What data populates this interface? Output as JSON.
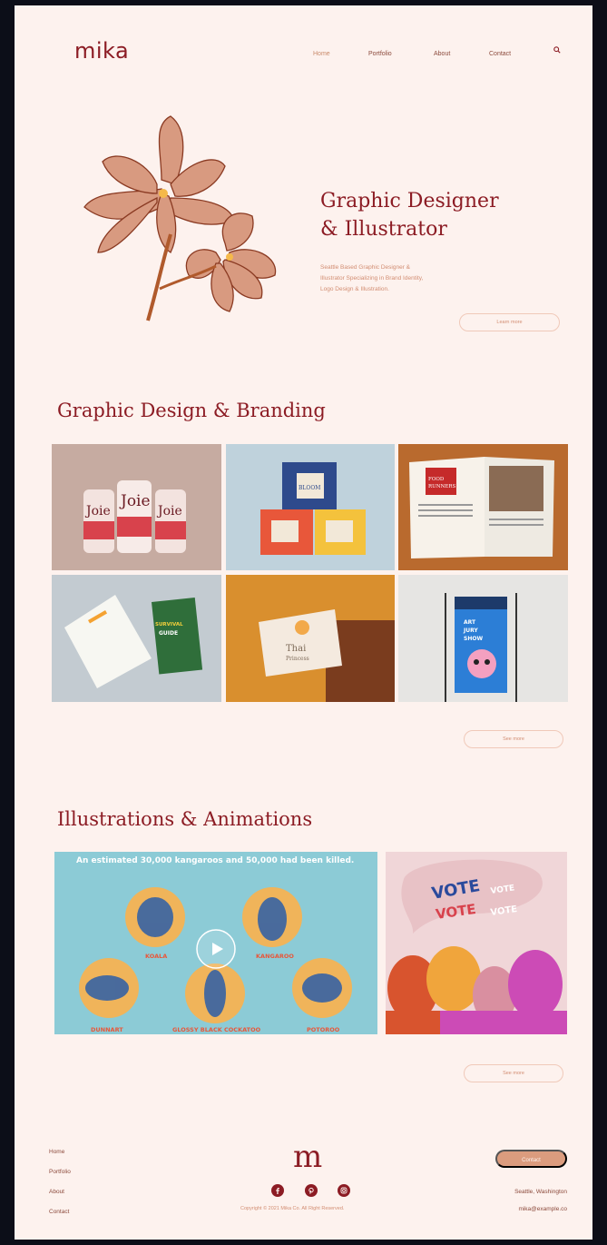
{
  "header": {
    "logo": "mika",
    "nav": [
      "Home",
      "Portfolio",
      "About",
      "Contact"
    ]
  },
  "hero": {
    "title_line1": "Graphic Designer",
    "title_line2": "& Illustrator",
    "subtitle_lines": [
      "Seattle Based Graphic Designer &",
      "Illustrator Specializing in Brand Identity,",
      "Logo Design & Illustration."
    ],
    "button": "Learn more"
  },
  "graphic_section": {
    "title": "Graphic Design & Branding",
    "button": "See more",
    "tiles": [
      {
        "name": "joie-cans",
        "text": "Joie"
      },
      {
        "name": "bloom-boxes",
        "text": "BLOOM"
      },
      {
        "name": "food-runners-magazine",
        "text": "FOOD RUNNERS"
      },
      {
        "name": "survival-guide",
        "text": "SURVIVAL GUIDE"
      },
      {
        "name": "thai-princess-cards",
        "text": "Thai Princess"
      },
      {
        "name": "art-jury-show-poster",
        "text": "ART JURY SHOW"
      }
    ]
  },
  "illustration_section": {
    "title": "Illustrations & Animations",
    "button": "See more",
    "video_caption": "An estimated 30,000 kangaroos and 50,000 had been killed.",
    "animal_labels": [
      "KOALA",
      "KANGAROO",
      "DUNNART",
      "GLOSSY BLACK COCKATOO",
      "POTOROO"
    ],
    "vote_words": [
      "VOTE",
      "VOTE",
      "VOTE",
      "VOTE"
    ]
  },
  "footer": {
    "links": [
      "Home",
      "Portfolio",
      "About",
      "Contact"
    ],
    "mark": "m",
    "copyright": "Copyright © 2021 Mika Co. All Right Reserved.",
    "contact_button": "Contact",
    "location": "Seattle, Washington",
    "email": "mika@example.co"
  },
  "colors": {
    "page_bg": "#fdf2ee",
    "brand": "#8c1c24",
    "accent": "#db9c7e"
  }
}
